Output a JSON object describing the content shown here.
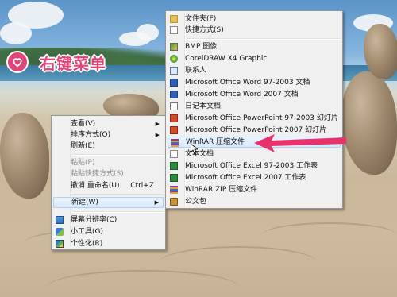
{
  "header": {
    "title": "右键菜单"
  },
  "context_menu": {
    "items": [
      {
        "label": "查看(V)",
        "has_submenu": true
      },
      {
        "label": "排序方式(O)",
        "has_submenu": true
      },
      {
        "label": "刷新(E)"
      },
      {
        "label": "粘贴(P)",
        "disabled": true
      },
      {
        "label": "粘贴快捷方式(S)",
        "disabled": true
      },
      {
        "label": "撤消 重命名(U)",
        "shortcut": "Ctrl+Z"
      },
      {
        "label": "新建(W)",
        "has_submenu": true,
        "highlighted": true
      },
      {
        "label": "屏幕分辨率(C)",
        "icon": "display-icon"
      },
      {
        "label": "小工具(G)",
        "icon": "gadgets-icon"
      },
      {
        "label": "个性化(R)",
        "icon": "personalize-icon"
      }
    ]
  },
  "new_submenu": {
    "items": [
      {
        "label": "文件夹(F)",
        "icon": "folder-icon"
      },
      {
        "label": "快捷方式(S)",
        "icon": "shortcut-icon"
      },
      {
        "label": "BMP 图像",
        "icon": "bmp-image-icon"
      },
      {
        "label": "CorelDRAW X4 Graphic",
        "icon": "coreldraw-icon"
      },
      {
        "label": "联系人",
        "icon": "contact-icon"
      },
      {
        "label": "Microsoft Office Word 97-2003 文档",
        "icon": "word-doc-icon"
      },
      {
        "label": "Microsoft Office Word 2007 文档",
        "icon": "word-docx-icon"
      },
      {
        "label": "日记本文档",
        "icon": "journal-icon"
      },
      {
        "label": "Microsoft Office PowerPoint 97-2003 幻灯片",
        "icon": "ppt-icon"
      },
      {
        "label": "Microsoft Office PowerPoint 2007 幻灯片",
        "icon": "pptx-icon"
      },
      {
        "label": "WinRAR 压缩文件",
        "icon": "winrar-icon",
        "highlighted": true
      },
      {
        "label": "文本文档",
        "icon": "text-doc-icon"
      },
      {
        "label": "Microsoft Office Excel 97-2003 工作表",
        "icon": "excel-xls-icon"
      },
      {
        "label": "Microsoft Office Excel 2007 工作表",
        "icon": "excel-xlsx-icon"
      },
      {
        "label": "WinRAR ZIP 压缩文件",
        "icon": "winrar-zip-icon"
      },
      {
        "label": "公文包",
        "icon": "briefcase-icon"
      }
    ]
  },
  "colors": {
    "badge": "#e0457a",
    "callout_arrow": "#e8336a",
    "menu_bg": "#f0f0f0",
    "highlight": "#d9e9fb"
  }
}
